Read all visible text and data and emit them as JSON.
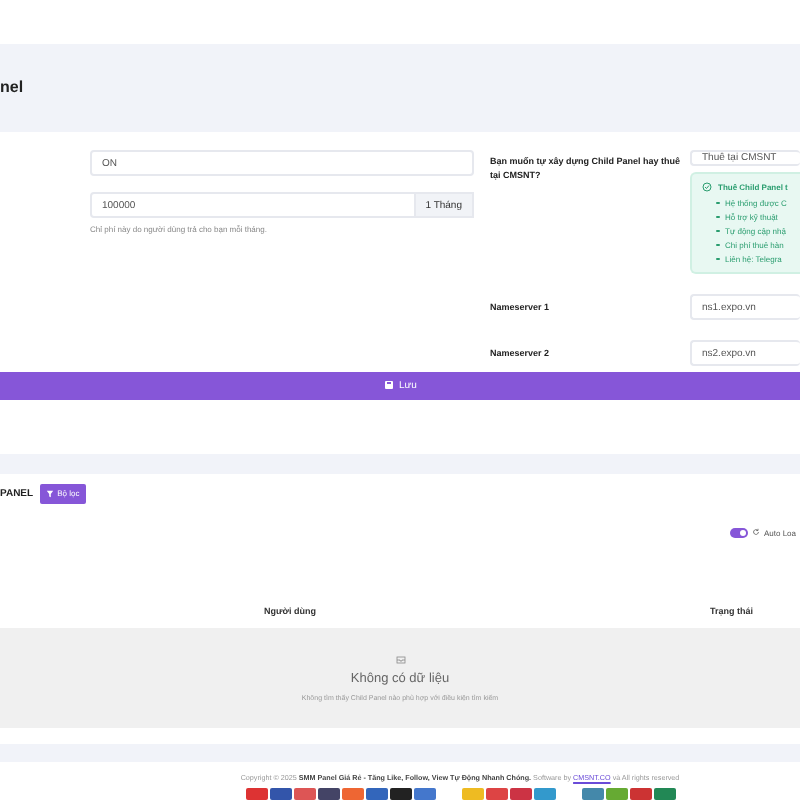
{
  "header": {
    "title": "nel"
  },
  "form": {
    "status_value": "ON",
    "price_value": "100000",
    "price_unit": "1 Tháng",
    "price_hint": "Chỉ phí này do người dùng trả cho bạn mỗi tháng.",
    "mode_label": "Bạn muốn tự xây dựng Child Panel hay thuê tại CMSNT?",
    "mode_value": "Thuê tại CMSNT",
    "alert": {
      "title": "Thuê Child Panel t",
      "items": [
        "Hệ thống được C",
        "Hỗ trợ kỹ thuật",
        "Tự động cập nhậ",
        "Chi phí thuê hàn",
        "Liên hệ: Telegra"
      ]
    },
    "nameservers": [
      {
        "label": "Nameserver 1",
        "value": "ns1.expo.vn"
      },
      {
        "label": "Nameserver 2",
        "value": "ns2.expo.vn"
      }
    ],
    "save_button": "Lưu"
  },
  "list": {
    "title": "PANEL",
    "filter_button": "Bộ lọc",
    "auto_load": {
      "label": "Auto Loa",
      "on": true
    },
    "columns": [
      "Người dùng",
      "Trạng thái"
    ],
    "empty_title": "Không có dữ liệu",
    "empty_text": "Không tìm thấy Child Panel nào phù hợp với điều kiện tìm kiếm"
  },
  "footer": {
    "prefix": "Copyright © 2025",
    "site": "SMM Panel Giá Rẻ - Tăng Like, Follow, View Tự Động Nhanh Chóng.",
    "software": "Software by",
    "link": "CMSNT.CO",
    "suffix": "và All rights reserved"
  }
}
